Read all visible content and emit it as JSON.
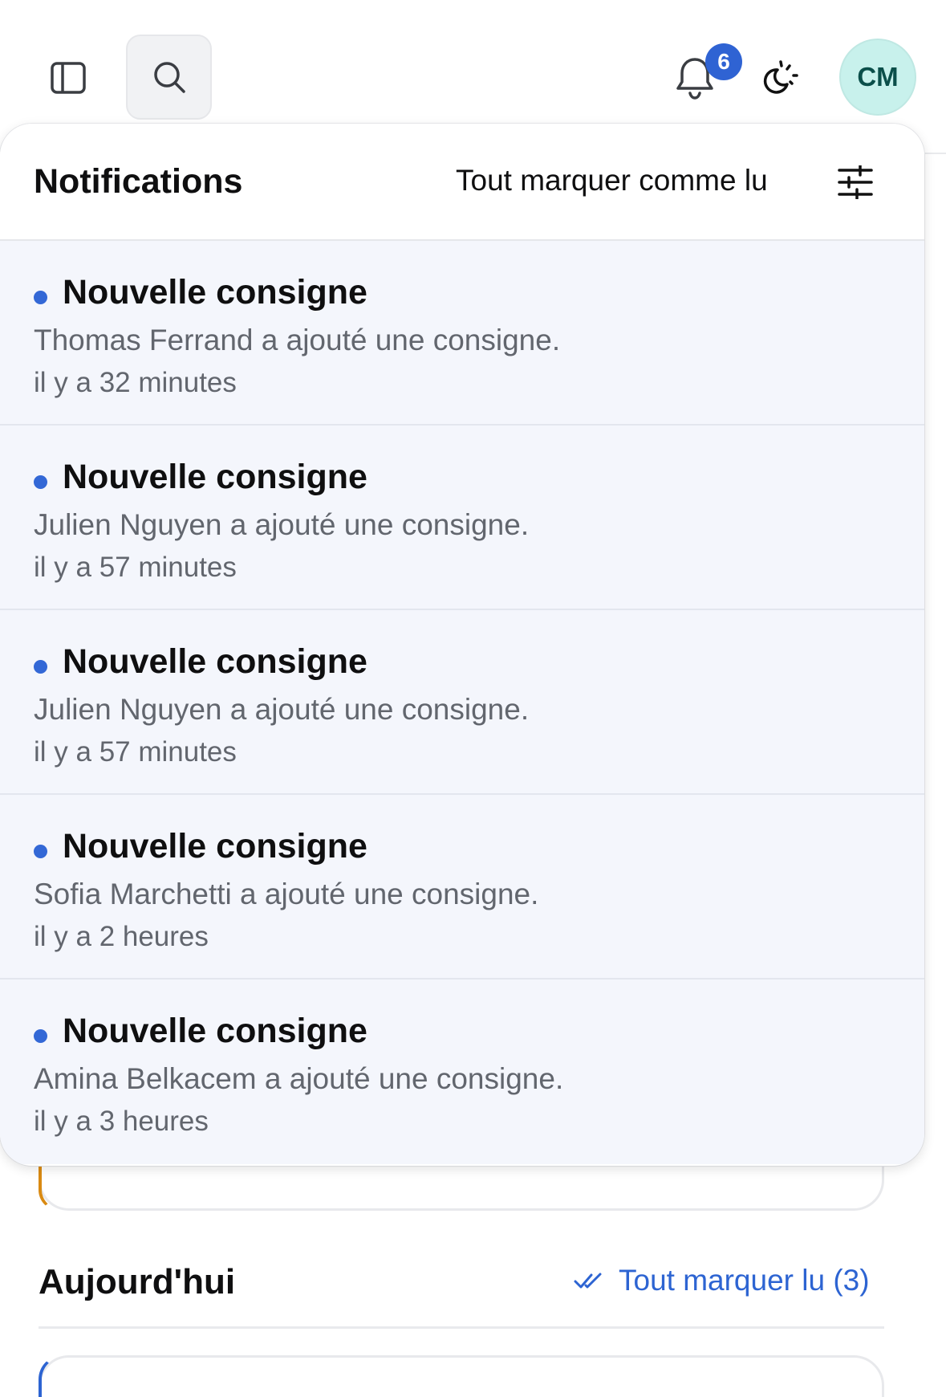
{
  "header": {
    "notification_count": "6",
    "avatar_initials": "CM"
  },
  "notifications": {
    "title": "Notifications",
    "mark_all_label": "Tout marquer comme lu",
    "items": [
      {
        "title": "Nouvelle consigne",
        "message": "Thomas Ferrand a ajouté une consigne.",
        "time": "il y a 32 minutes"
      },
      {
        "title": "Nouvelle consigne",
        "message": "Julien Nguyen a ajouté une consigne.",
        "time": "il y a 57 minutes"
      },
      {
        "title": "Nouvelle consigne",
        "message": "Julien Nguyen a ajouté une consigne.",
        "time": "il y a 57 minutes"
      },
      {
        "title": "Nouvelle consigne",
        "message": "Sofia Marchetti a ajouté une consigne.",
        "time": "il y a 2 heures"
      },
      {
        "title": "Nouvelle consigne",
        "message": "Amina Belkacem a ajouté une consigne.",
        "time": "il y a 3 heures"
      }
    ]
  },
  "section": {
    "title": "Aujourd'hui",
    "mark_read_label": "Tout marquer lu (3)"
  },
  "colors": {
    "accent_blue": "#2f63d3",
    "unread_bg": "#f4f6fc",
    "avatar_bg": "#c8f1ec",
    "card_accent_orange": "#d98a12"
  }
}
